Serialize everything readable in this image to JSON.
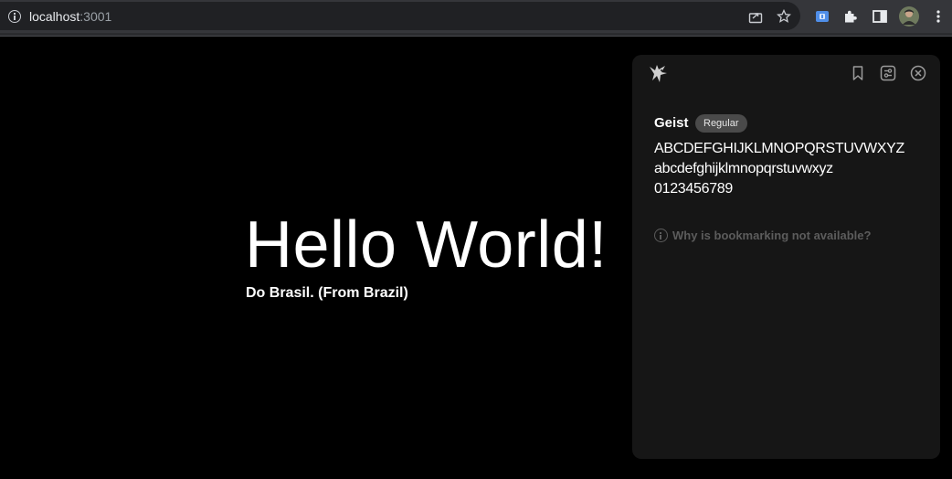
{
  "browser": {
    "url_host": "localhost",
    "url_port": ":3001",
    "icons": {
      "site_info": "info-icon",
      "share": "share-icon",
      "bookmark": "star-icon",
      "extension_active": "extension-badge-icon",
      "extensions": "puzzle-icon",
      "side_panel": "side-panel-icon",
      "profile": "avatar",
      "menu": "kebab-menu-icon"
    }
  },
  "page": {
    "headline": "Hello World!",
    "subtitle": "Do Brasil. (From Brazil)"
  },
  "panel": {
    "font_name": "Geist",
    "weight_badge": "Regular",
    "sample_upper": "ABCDEFGHIJKLMNOPQRSTUVWXYZ",
    "sample_lower": "abcdefghijklmnopqrstuvwxyz",
    "sample_digits": "0123456789",
    "bookmark_info": "Why is bookmarking not available?",
    "icons": {
      "logo": "bird-logo-icon",
      "bookmark": "bookmark-icon",
      "settings": "sliders-icon",
      "close": "close-icon"
    }
  },
  "colors": {
    "page_bg": "#000000",
    "panel_bg": "#161616",
    "badge_bg": "#4a4a4a",
    "muted_text": "#5c5c5c",
    "toolbar_bg": "#35363a",
    "omnibox_bg": "#202124"
  }
}
